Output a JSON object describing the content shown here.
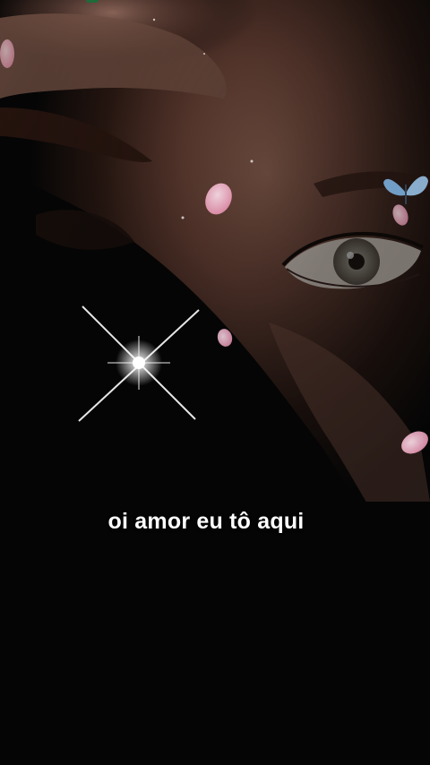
{
  "caption": {
    "text": "oi amor eu tô aqui"
  },
  "scene": {
    "subject": "face-closeup-icon",
    "decorations": [
      "sparkle-icon",
      "petal-icon",
      "butterfly-icon"
    ],
    "colors": {
      "background": "#050505",
      "skin": "#8a5a4a",
      "petal": "#f2b8cc",
      "sparkle": "#ffffff",
      "butterfly": "#7fb6e6",
      "caption": "#ffffff"
    }
  }
}
